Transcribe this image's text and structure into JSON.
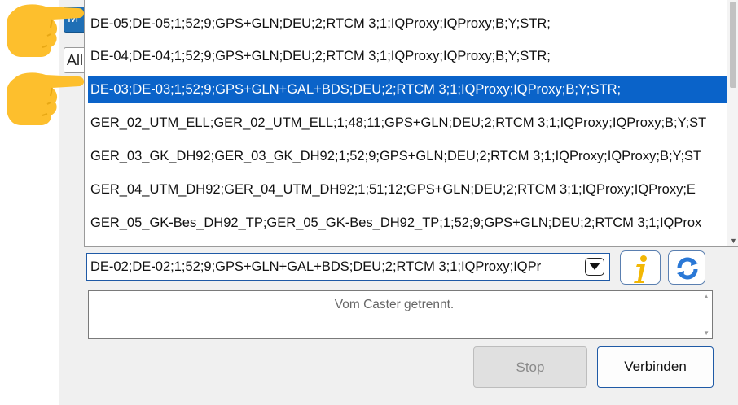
{
  "under_window": {
    "blue_tab_label": "M",
    "all_tab_label": "All"
  },
  "dropdown": {
    "items": [
      {
        "label": "DE-05;DE-05;1;52;9;GPS+GLN;DEU;2;RTCM 3;1;IQProxy;IQProxy;B;Y;STR;"
      },
      {
        "label": "DE-04;DE-04;1;52;9;GPS+GLN;DEU;2;RTCM 3;1;IQProxy;IQProxy;B;Y;STR;"
      },
      {
        "label": "DE-03;DE-03;1;52;9;GPS+GLN+GAL+BDS;DEU;2;RTCM 3;1;IQProxy;IQProxy;B;Y;STR;"
      },
      {
        "label": "GER_02_UTM_ELL;GER_02_UTM_ELL;1;48;11;GPS+GLN;DEU;2;RTCM 3;1;IQProxy;IQProxy;B;Y;ST"
      },
      {
        "label": "GER_03_GK_DH92;GER_03_GK_DH92;1;52;9;GPS+GLN;DEU;2;RTCM 3;1;IQProxy;IQProxy;B;Y;ST"
      },
      {
        "label": "GER_04_UTM_DH92;GER_04_UTM_DH92;1;51;12;GPS+GLN;DEU;2;RTCM 3;1;IQProxy;IQProxy;E"
      },
      {
        "label": "GER_05_GK-Bes_DH92_TP;GER_05_GK-Bes_DH92_TP;1;52;9;GPS+GLN;DEU;2;RTCM 3;1;IQProx"
      }
    ],
    "selected_index": 2
  },
  "combo": {
    "value": "DE-02;DE-02;1;52;9;GPS+GLN+GAL+BDS;DEU;2;RTCM 3;1;IQProxy;IQPr"
  },
  "status": {
    "text": "Vom Caster getrennt."
  },
  "buttons": {
    "stop_label": "Stop",
    "connect_label": "Verbinden"
  },
  "icons": {
    "info": "info-icon",
    "refresh": "refresh-icon",
    "dropdown_arrow": "chevron-down-icon",
    "pointer_hand": "pointing-hand-icon"
  },
  "colors": {
    "selection": "#0a63c9",
    "info_yellow": "#f2b705",
    "refresh_blue": "#2a78d6",
    "hand_yellow": "#fdbf2d"
  }
}
